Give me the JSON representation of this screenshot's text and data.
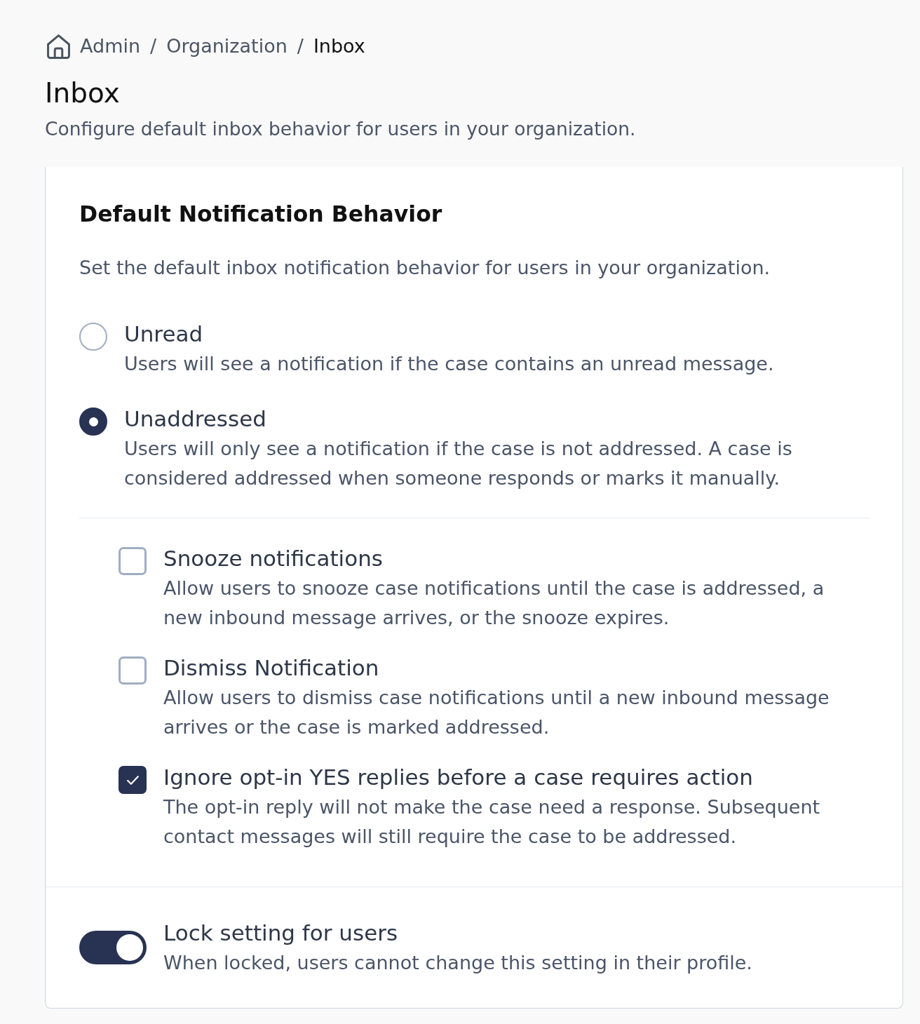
{
  "breadcrumb": {
    "separator": "/",
    "items": [
      {
        "label": "Admin",
        "current": false
      },
      {
        "label": "Organization",
        "current": false
      },
      {
        "label": "Inbox",
        "current": true
      }
    ]
  },
  "page": {
    "title": "Inbox",
    "subtitle": "Configure default inbox behavior for users in your organization."
  },
  "card": {
    "title": "Default Notification Behavior",
    "description": "Set the default inbox notification behavior for users in your organization.",
    "options": [
      {
        "label": "Unread",
        "description": "Users will see a notification if the case contains an unread message.",
        "selected": false
      },
      {
        "label": "Unaddressed",
        "description": "Users will only see a notification if the case is not addressed. A case is considered addressed when someone responds or marks it manually.",
        "selected": true
      }
    ],
    "settings": [
      {
        "label": "Snooze notifications",
        "description": "Allow users to snooze case notifications until the case is addressed, a new inbound message arrives, or the snooze expires.",
        "checked": false
      },
      {
        "label": "Dismiss Notification",
        "description": "Allow users to dismiss case notifications until a new inbound message arrives or the case is marked addressed.",
        "checked": false
      },
      {
        "label": "Ignore opt-in YES replies before a case requires action",
        "description": "The opt-in reply will not make the case need a response. Subsequent contact messages will still require the case to be addressed.",
        "checked": true
      }
    ],
    "lock": {
      "label": "Lock setting for users",
      "description": "When locked, users cannot change this setting in their profile.",
      "on": true
    }
  }
}
